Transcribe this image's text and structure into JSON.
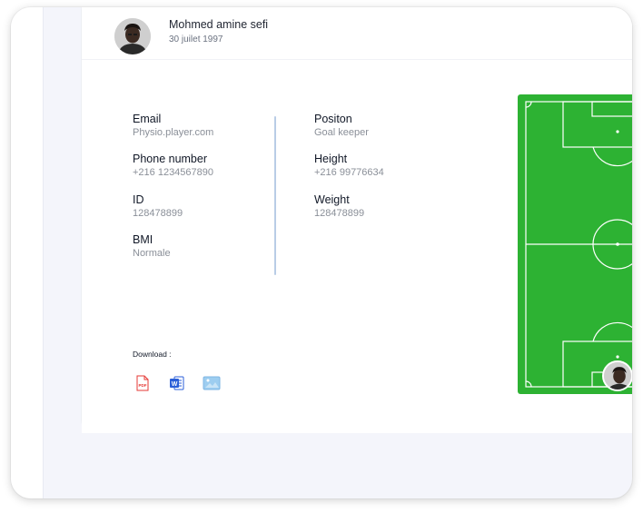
{
  "profile": {
    "name": "Mohmed amine sefi",
    "dob": "30 juilet 1997"
  },
  "info_left": [
    {
      "label": "Email",
      "value": "Physio.player.com"
    },
    {
      "label": "Phone number",
      "value": "+216 1234567890"
    },
    {
      "label": "ID",
      "value": "128478899"
    },
    {
      "label": "BMI",
      "value": "Normale"
    }
  ],
  "info_right": [
    {
      "label": "Positon",
      "value": "Goal keeper"
    },
    {
      "label": "Height",
      "value": "+216 99776634"
    },
    {
      "label": "Weight",
      "value": "128478899"
    }
  ],
  "download": {
    "label": "Download :",
    "icons": [
      {
        "name": "pdf-icon",
        "text": "PDF",
        "color": "#e53935"
      },
      {
        "name": "word-icon",
        "text": "W",
        "color": "#2b5fd8"
      },
      {
        "name": "image-icon",
        "color": "#7fb6e3"
      }
    ]
  },
  "pitch": {
    "color": "#2db233",
    "line_color": "#ffffff"
  }
}
